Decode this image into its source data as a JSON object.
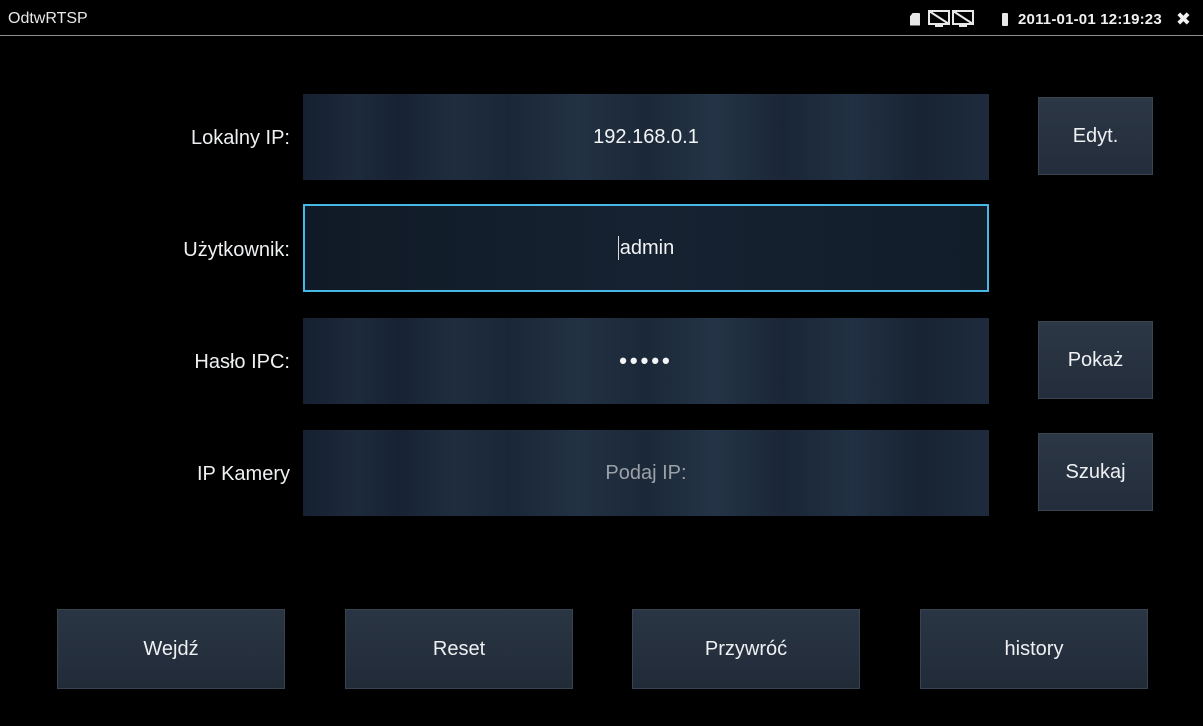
{
  "status_bar": {
    "app_title": "OdtwRTSP",
    "datetime": "2011-01-01 12:19:23",
    "icons": [
      "sd-card-icon",
      "network-disconnected-icon",
      "battery-icon",
      "close-icon"
    ],
    "close_glyph": "✖"
  },
  "form": {
    "local_ip": {
      "label": "Lokalny IP:",
      "value": "192.168.0.1",
      "button": "Edyt."
    },
    "username": {
      "label": "Użytkownik:",
      "value": "admin"
    },
    "password": {
      "label": "Hasło IPC:",
      "value": "•••••",
      "button": "Pokaż"
    },
    "camera_ip": {
      "label": "IP Kamery",
      "placeholder": "Podaj IP:",
      "button": "Szukaj"
    }
  },
  "actions": {
    "enter": "Wejdź",
    "reset": "Reset",
    "restore": "Przywróć",
    "history": "history"
  },
  "colors": {
    "background": "#000000",
    "active_border": "#47b8e6",
    "field_bg": "#1c2939",
    "button_bg": "#28333f"
  }
}
